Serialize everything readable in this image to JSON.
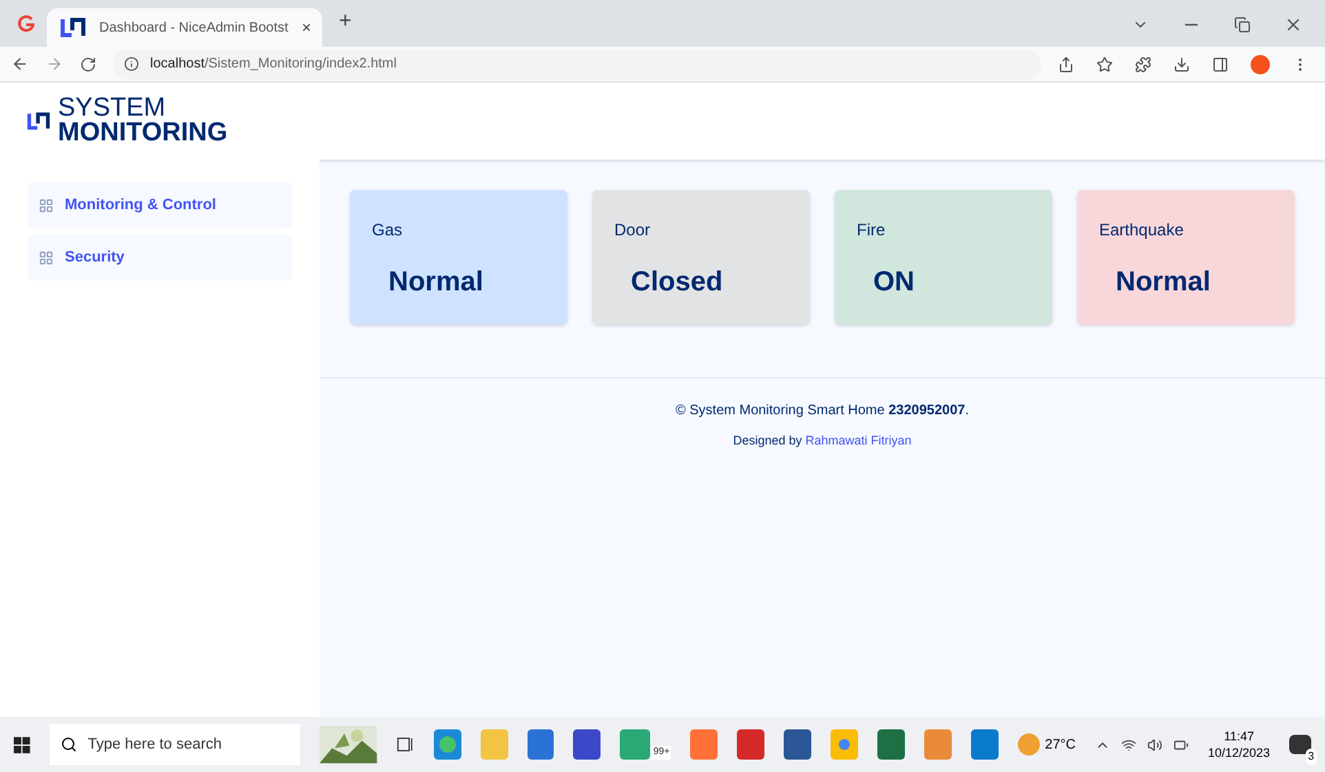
{
  "browser": {
    "tabs": [
      {
        "title": "Dashboard - NiceAdmin Bootst",
        "selected": true
      }
    ],
    "close": "×",
    "new_tab": "+",
    "url_host": "localhost",
    "url_path": "/Sistem_Monitoring/index2.html"
  },
  "brand": {
    "line1": "SYSTEM",
    "line2": "MONITORING"
  },
  "sidebar": {
    "items": [
      {
        "label": "Monitoring & Control"
      },
      {
        "label": "Security"
      }
    ]
  },
  "cards": [
    {
      "title": "Gas",
      "value": "Normal",
      "color": "#cfe2ff"
    },
    {
      "title": "Door",
      "value": "Closed",
      "color": "#e2e3e5"
    },
    {
      "title": "Fire",
      "value": "ON",
      "color": "#d1e7dd"
    },
    {
      "title": "Earthquake",
      "value": "Normal",
      "color": "#f8d7da"
    }
  ],
  "footer": {
    "copyright": "© System Monitoring Smart Home **2320952007**.",
    "designed_by": "Designed by",
    "author": "Rahmawati Fitriyan"
  },
  "taskbar": {
    "search_placeholder": "Type here to search",
    "mail_badge": "99+",
    "weather": "27°C",
    "time": "11:47",
    "date": "10/12/2023",
    "notifications": "3"
  }
}
